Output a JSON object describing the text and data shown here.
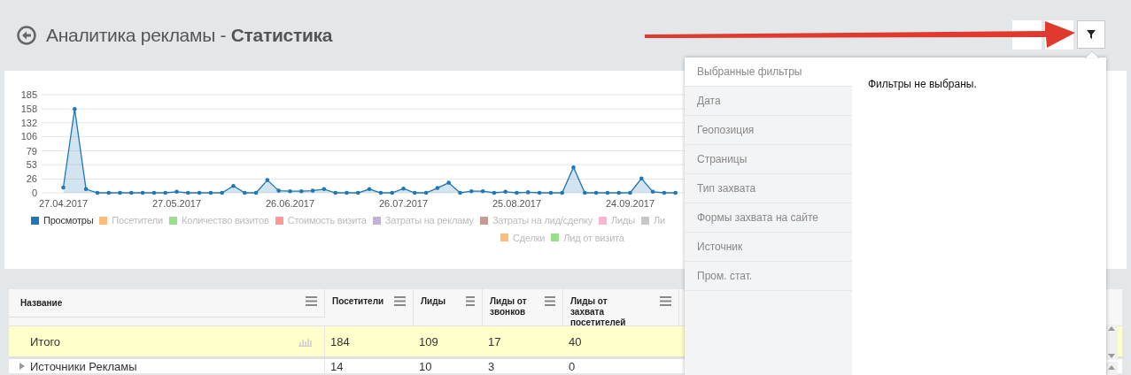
{
  "header": {
    "title": "Аналитика рекламы - **Статистика**"
  },
  "chart": {
    "chart_data": {
      "type": "area",
      "categories": [
        "27.04.2017",
        null,
        null,
        null,
        null,
        null,
        null,
        null,
        null,
        null,
        "27.05.2017",
        null,
        null,
        null,
        null,
        null,
        null,
        null,
        null,
        null,
        "26.06.2017",
        null,
        null,
        null,
        null,
        null,
        null,
        null,
        null,
        null,
        "26.07.2017",
        null,
        null,
        null,
        null,
        null,
        null,
        null,
        null,
        null,
        "25.08.2017",
        null,
        null,
        null,
        null,
        null,
        null,
        null,
        null,
        null,
        "24.09.2017",
        null,
        null,
        null,
        null
      ],
      "series": [
        {
          "color": "#1f77b4",
          "values": [
            10,
            158,
            7,
            0,
            0,
            0,
            0,
            0,
            0,
            0,
            2,
            0,
            0,
            0,
            0,
            13,
            0,
            0,
            24,
            4,
            3,
            3,
            4,
            7,
            0,
            0,
            0,
            7,
            0,
            0,
            8,
            0,
            0,
            9,
            19,
            0,
            3,
            3,
            0,
            2,
            0,
            1,
            0,
            0,
            0,
            48,
            0,
            0,
            0,
            0,
            0,
            27,
            2,
            0,
            0
          ]
        }
      ],
      "grid": true,
      "ylim": [
        0,
        185
      ],
      "yticks": [
        0,
        26,
        53,
        79,
        106,
        132,
        158,
        185
      ]
    },
    "legend_rows": [
      [
        {
          "label": "Просмотры",
          "color": "#1f77b4",
          "active": true
        },
        {
          "label": "Посетители",
          "color": "#ffbb78",
          "active": false
        },
        {
          "label": "Количество визитов",
          "color": "#98df8a",
          "active": false
        },
        {
          "label": "Стоимость визита",
          "color": "#ff9896",
          "active": false
        },
        {
          "label": "Затраты на рекламу",
          "color": "#c5b0d5",
          "active": false
        },
        {
          "label": "Затраты на лид/сделку",
          "color": "#c49c94",
          "active": false
        },
        {
          "label": "Лиды",
          "color": "#f7b6d2",
          "active": false
        },
        {
          "label": "Ли",
          "color": "#c7c7c7",
          "active": false
        }
      ],
      [
        {
          "label": "Сделки",
          "color": "#ffbb78",
          "active": false
        },
        {
          "label": "Лид от визита",
          "color": "#98df8a",
          "active": false
        }
      ]
    ]
  },
  "table": {
    "columns": [
      "Название",
      "Посетители",
      "Лиды",
      "Лиды от звонков",
      "Лиды от захвата посетителей"
    ],
    "rows": [
      {
        "cells": [
          "Итого",
          "184",
          "109",
          "17",
          "40"
        ],
        "total": true
      },
      {
        "cells": [
          "Источники Рекламы",
          "14",
          "10",
          "3",
          "0"
        ],
        "total": false
      }
    ]
  },
  "filter_panel": {
    "items": [
      {
        "label": "Выбранные фильтры",
        "selected": true
      },
      {
        "label": "Дата",
        "selected": false
      },
      {
        "label": "Геопозиция",
        "selected": false
      },
      {
        "label": "Страницы",
        "selected": false
      },
      {
        "label": "Тип захвата",
        "selected": false
      },
      {
        "label": "Формы захвата на сайте",
        "selected": false
      },
      {
        "label": "Источник",
        "selected": false
      },
      {
        "label": "Пром. стат.",
        "selected": false
      }
    ],
    "message": "Фильтры не выбраны."
  }
}
